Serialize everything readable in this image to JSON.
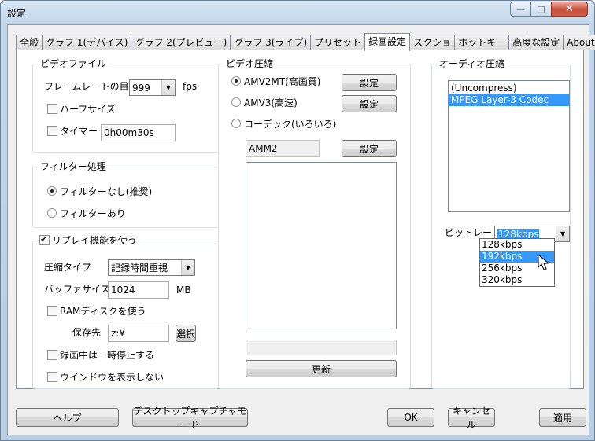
{
  "window": {
    "title": "設定",
    "min_glyph": "—",
    "max_glyph": "□",
    "close_glyph": "✕"
  },
  "tabs": [
    {
      "label": "全般"
    },
    {
      "label": "グラフ 1(デバイス)"
    },
    {
      "label": "グラフ 2(プレビュー)"
    },
    {
      "label": "グラフ 3(ライブ)"
    },
    {
      "label": "プリセット"
    },
    {
      "label": "録画設定",
      "active": true
    },
    {
      "label": "スクショ"
    },
    {
      "label": "ホットキー"
    },
    {
      "label": "高度な設定"
    },
    {
      "label": "About"
    }
  ],
  "video_file": {
    "group_label": "ビデオファイル",
    "framerate_label": "フレームレートの目安",
    "framerate_value": "999",
    "framerate_unit": "fps",
    "half_size_label": "ハーフサイズ",
    "timer_label": "タイマー",
    "timer_value": "0h00m30s"
  },
  "filter": {
    "group_label": "フィルター処理",
    "none_label": "フィルターなし(推奨)",
    "with_label": "フィルターあり"
  },
  "replay": {
    "group_label": "リプレイ機能を使う",
    "compression_type_label": "圧縮タイプ",
    "compression_type_value": "記録時間重視",
    "buffer_label": "バッファサイズ",
    "buffer_value": "1024",
    "buffer_unit": "MB",
    "ram_disk_label": "RAMディスクを使う",
    "save_to_label": "保存先",
    "save_to_value": "z:¥",
    "select_button": "選択",
    "pause_label": "録画中は一時停止する",
    "hide_window_label": "ウインドウを表示しない"
  },
  "video_compression": {
    "group_label": "ビデオ圧縮",
    "amv2mt_label": "AMV2MT(高画質)",
    "amv3_label": "AMV3(高速)",
    "codec_label": "コーデック(いろいろ)",
    "settings_button": "設定",
    "codec_field_value": "AMM2",
    "update_button": "更新"
  },
  "audio_compression": {
    "group_label": "オーディオ圧縮",
    "codecs": [
      {
        "label": "(Uncompress)"
      },
      {
        "label": "MPEG Layer-3 Codec",
        "selected": true
      }
    ],
    "bitrate_label": "ビットレート",
    "bitrate_value": "128kbps",
    "bitrate_options": [
      {
        "label": "128kbps"
      },
      {
        "label": "192kbps",
        "highlighted": true
      },
      {
        "label": "256kbps"
      },
      {
        "label": "320kbps"
      }
    ]
  },
  "footer": {
    "help_button": "ヘルプ",
    "desktop_capture_button": "デスクトップキャプチャモード",
    "ok_button": "OK",
    "cancel_button": "キャンセル",
    "apply_button": "適用"
  },
  "colors": {
    "selection": "#3399ff",
    "close_button": "#c74f3b"
  }
}
